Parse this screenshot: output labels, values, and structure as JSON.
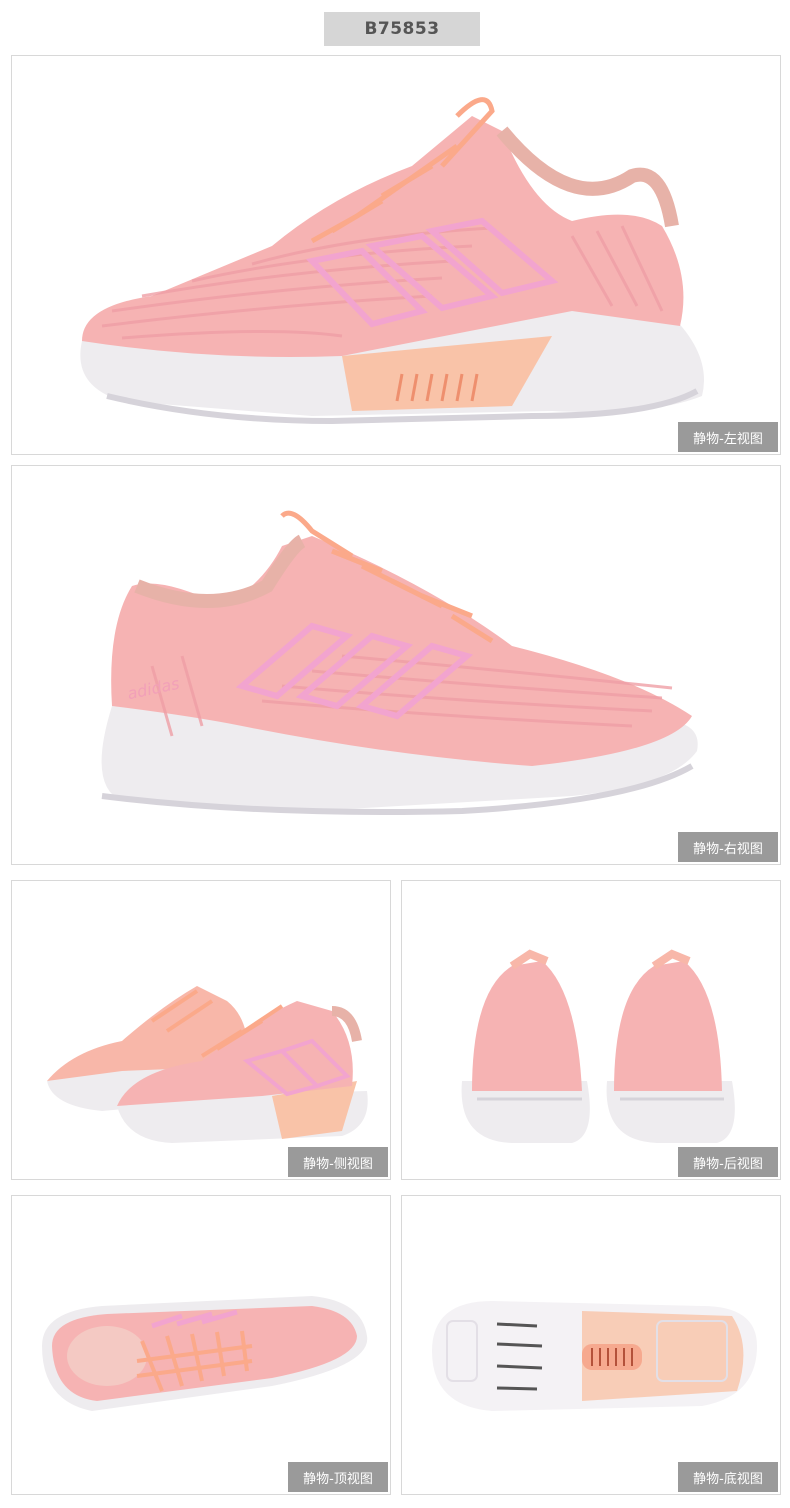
{
  "product_code": "B75853",
  "views": {
    "left": "静物-左视图",
    "right": "静物-右视图",
    "side": "静物-侧视图",
    "back": "静物-后视图",
    "top": "静物-顶视图",
    "bottom": "静物-底视图"
  },
  "brand_text": "adidas",
  "colors": {
    "upper": "#f6b3b3",
    "upper_dark": "#ef9fa6",
    "stripes": "#f2a4cf",
    "laces": "#fba98a",
    "midsole": "#f1f0f3",
    "heel_insert": "#f9c3a8",
    "caption_bg": "#9a9a9a",
    "tag_bg": "#d6d6d6"
  }
}
